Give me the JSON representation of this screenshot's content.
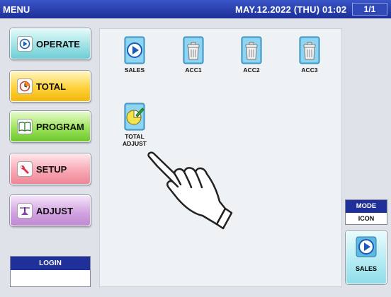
{
  "titlebar": {
    "title": "MENU",
    "datetime": "MAY.12.2022 (THU)  01:02",
    "page_indicator": "1/1"
  },
  "menu": [
    {
      "label": "OPERATE",
      "icon": "play-icon"
    },
    {
      "label": "TOTAL",
      "icon": "clock-icon"
    },
    {
      "label": "PROGRAM",
      "icon": "book-icon"
    },
    {
      "label": "SETUP",
      "icon": "wrench-icon"
    },
    {
      "label": "ADJUST",
      "icon": "scale-icon"
    }
  ],
  "login": {
    "label": "LOGIN",
    "value": ""
  },
  "tiles": [
    {
      "label": "SALES",
      "icon": "play-icon"
    },
    {
      "label": "ACC1",
      "icon": "trash-icon"
    },
    {
      "label": "ACC2",
      "icon": "trash-icon"
    },
    {
      "label": "ACC3",
      "icon": "trash-icon"
    },
    {
      "label_line1": "TOTAL",
      "label_line2": "ADJUST",
      "icon": "pie-chart-icon"
    }
  ],
  "mode": {
    "label": "MODE",
    "value": "ICON"
  },
  "quick": {
    "label": "SALES",
    "icon": "play-icon"
  },
  "colors": {
    "title_bar": "#1d2f96",
    "panel_header": "#1f309a"
  }
}
